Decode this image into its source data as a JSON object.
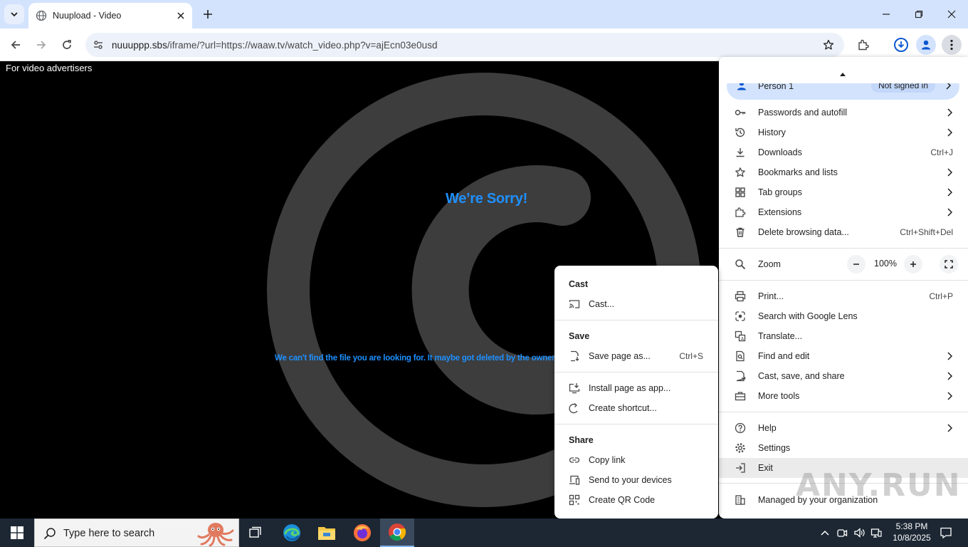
{
  "browser": {
    "tab": {
      "title": "Nuupload - Video",
      "favicon": "globe-icon"
    },
    "address": {
      "host": "nuuuppp.sbs",
      "path": "/iframe/?url=https://waaw.tv/watch_video.php?v=ajEcn03e0usd"
    },
    "window_controls": [
      "minimize-icon",
      "maximize-icon",
      "close-icon"
    ]
  },
  "page": {
    "advertisers_link": "For video advertisers",
    "title": "We’re Sorry!",
    "message": "We can't find the file you are looking for. It maybe got deleted by the owner or w",
    "accent_color": "#1e90ff"
  },
  "main_menu": {
    "profile": {
      "name": "Person 1",
      "status": "Not signed in"
    },
    "items": [
      {
        "label": "Passwords and autofill",
        "icon": "key-icon",
        "shortcut": "",
        "submenu": true
      },
      {
        "label": "History",
        "icon": "history-icon",
        "shortcut": "",
        "submenu": true
      },
      {
        "label": "Downloads",
        "icon": "download-icon",
        "shortcut": "Ctrl+J",
        "submenu": false
      },
      {
        "label": "Bookmarks and lists",
        "icon": "star-icon",
        "shortcut": "",
        "submenu": true
      },
      {
        "label": "Tab groups",
        "icon": "tab-groups-icon",
        "shortcut": "",
        "submenu": true
      },
      {
        "label": "Extensions",
        "icon": "puzzle-icon",
        "shortcut": "",
        "submenu": true
      },
      {
        "label": "Delete browsing data...",
        "icon": "trash-icon",
        "shortcut": "Ctrl+Shift+Del",
        "submenu": false
      }
    ],
    "zoom": {
      "label": "Zoom",
      "value": "100%"
    },
    "items2": [
      {
        "label": "Print...",
        "icon": "print-icon",
        "shortcut": "Ctrl+P",
        "submenu": false
      },
      {
        "label": "Search with Google Lens",
        "icon": "lens-icon",
        "shortcut": "",
        "submenu": false
      },
      {
        "label": "Translate...",
        "icon": "translate-icon",
        "shortcut": "",
        "submenu": false
      },
      {
        "label": "Find and edit",
        "icon": "find-icon",
        "shortcut": "",
        "submenu": true
      },
      {
        "label": "Cast, save, and share",
        "icon": "cast-save-icon",
        "shortcut": "",
        "submenu": true
      },
      {
        "label": "More tools",
        "icon": "toolbox-icon",
        "shortcut": "",
        "submenu": true
      }
    ],
    "items3": [
      {
        "label": "Help",
        "icon": "help-icon",
        "shortcut": "",
        "submenu": true
      },
      {
        "label": "Settings",
        "icon": "settings-icon",
        "shortcut": "",
        "submenu": false
      },
      {
        "label": "Exit",
        "icon": "exit-icon",
        "shortcut": "",
        "submenu": false
      }
    ],
    "managed": "Managed by your organization"
  },
  "sub_menu": {
    "cast_header": "Cast",
    "cast_item": "Cast...",
    "save_header": "Save",
    "save_item": "Save page as...",
    "save_shortcut": "Ctrl+S",
    "install_item": "Install page as app...",
    "shortcut_item": "Create shortcut...",
    "share_header": "Share",
    "copy_link": "Copy link",
    "send_devices": "Send to your devices",
    "qr_code": "Create QR Code"
  },
  "taskbar": {
    "search_placeholder": "Type here to search",
    "time": "5:38 PM",
    "date": "10/8/2025",
    "apps": [
      "task-view-icon",
      "edge-icon",
      "file-explorer-icon",
      "firefox-icon",
      "chrome-icon"
    ]
  },
  "watermark": "ANY.RUN"
}
